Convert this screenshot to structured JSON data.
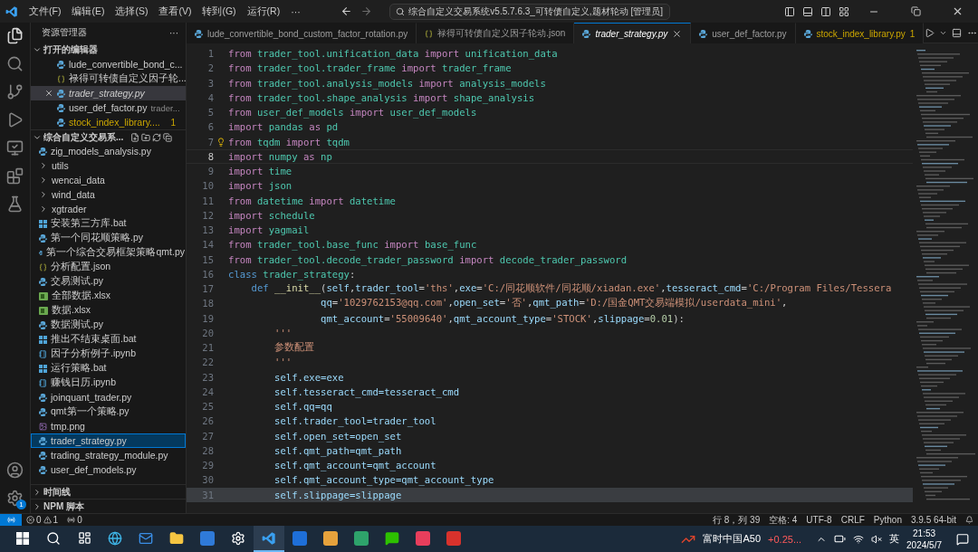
{
  "titlebar": {
    "menus": [
      "文件(F)",
      "编辑(E)",
      "选择(S)",
      "查看(V)",
      "转到(G)",
      "运行(R)",
      "···"
    ],
    "search": "综合自定义交易系统v5.5.7.6.3_可转债自定义,题材轮动 [管理员]"
  },
  "sidebar": {
    "title": "资源管理器",
    "more": "···",
    "open_editors": {
      "title": "打开的编辑器",
      "expanded": true,
      "items": [
        {
          "kind": "py",
          "name": "lude_convertible_bond_c...",
          "italic": false,
          "selected": false,
          "warning": false
        },
        {
          "kind": "json",
          "name": "禄得可转债自定义因子轮...",
          "italic": false,
          "selected": false,
          "warning": false
        },
        {
          "kind": "py",
          "name": "trader_strategy.py",
          "italic": true,
          "selected": true,
          "warning": false
        },
        {
          "kind": "py",
          "name": "user_def_factor.py",
          "description": "trader...",
          "italic": false,
          "selected": false,
          "warning": false
        },
        {
          "kind": "py",
          "name": "stock_index_library....",
          "badge": "1",
          "italic": false,
          "selected": false,
          "warning": true
        }
      ]
    },
    "folder": {
      "title": "综合自定义交易系...",
      "expanded": true,
      "items": [
        {
          "kind": "py",
          "name": "zig_models_analysis.py",
          "selected": false
        },
        {
          "kind": "folder",
          "name": "utils",
          "selected": false
        },
        {
          "kind": "folder",
          "name": "wencai_data",
          "selected": false
        },
        {
          "kind": "folder",
          "name": "wind_data",
          "selected": false
        },
        {
          "kind": "folder",
          "name": "xgtrader",
          "selected": false
        },
        {
          "kind": "bat",
          "name": "安装第三方库.bat",
          "selected": false
        },
        {
          "kind": "py",
          "name": "第一个同花顺策略.py",
          "selected": false
        },
        {
          "kind": "py",
          "name": "第一个综合交易框架策略qmt.py",
          "selected": false
        },
        {
          "kind": "json",
          "name": "分析配置.json",
          "selected": false
        },
        {
          "kind": "py",
          "name": "交易测试.py",
          "selected": false
        },
        {
          "kind": "xlsx",
          "name": "全部数据.xlsx",
          "selected": false
        },
        {
          "kind": "xlsx",
          "name": "数据.xlsx",
          "selected": false
        },
        {
          "kind": "py",
          "name": "数据测试.py",
          "selected": false
        },
        {
          "kind": "bat",
          "name": "推出不结束桌面.bat",
          "selected": false
        },
        {
          "kind": "ipynb",
          "name": "因子分析例子.ipynb",
          "selected": false
        },
        {
          "kind": "bat",
          "name": "运行策略.bat",
          "selected": false
        },
        {
          "kind": "ipynb",
          "name": "赚钱日历.ipynb",
          "selected": false
        },
        {
          "kind": "py",
          "name": "joinquant_trader.py",
          "selected": false
        },
        {
          "kind": "py",
          "name": "qmt第一个策略.py",
          "selected": false
        },
        {
          "kind": "png",
          "name": "tmp.png",
          "selected": false
        },
        {
          "kind": "py",
          "name": "trader_strategy.py",
          "selected": true
        },
        {
          "kind": "py",
          "name": "trading_strategy_module.py",
          "selected": false
        },
        {
          "kind": "py",
          "name": "user_def_models.py",
          "selected": false
        }
      ]
    },
    "bottom_sections": [
      {
        "title": "时间线",
        "expanded": false
      },
      {
        "title": "NPM 脚本",
        "expanded": false
      }
    ]
  },
  "activity_bar": {
    "settings_badge": "1"
  },
  "tabs": [
    {
      "kind": "py",
      "label": "lude_convertible_bond_custom_factor_rotation.py",
      "selected": false,
      "italic": false,
      "warning": false
    },
    {
      "kind": "json",
      "label": "禄得可转债自定义因子轮动.json",
      "selected": false,
      "italic": false,
      "warning": false
    },
    {
      "kind": "py",
      "label": "trader_strategy.py",
      "selected": true,
      "italic": true,
      "warning": false
    },
    {
      "kind": "py",
      "label": "user_def_factor.py",
      "selected": false,
      "italic": false,
      "warning": false
    },
    {
      "kind": "py",
      "label": "stock_index_library.py",
      "badge": "1",
      "selected": false,
      "italic": false,
      "warning": true
    }
  ],
  "editor": {
    "lines": [
      {
        "n": "1",
        "current": false,
        "selected": false,
        "lightbulb": false,
        "tokens": [
          {
            "kind": "keyword",
            "text": "from "
          },
          {
            "kind": "module",
            "text": "trader_tool.unification_data "
          },
          {
            "kind": "keyword",
            "text": "import "
          },
          {
            "kind": "module",
            "text": "unification_data"
          }
        ]
      },
      {
        "n": "2",
        "current": false,
        "selected": false,
        "lightbulb": false,
        "tokens": [
          {
            "kind": "keyword",
            "text": "from "
          },
          {
            "kind": "module",
            "text": "trader_tool.trader_frame "
          },
          {
            "kind": "keyword",
            "text": "import "
          },
          {
            "kind": "module",
            "text": "trader_frame"
          }
        ]
      },
      {
        "n": "3",
        "current": false,
        "selected": false,
        "lightbulb": false,
        "tokens": [
          {
            "kind": "keyword",
            "text": "from "
          },
          {
            "kind": "module",
            "text": "trader_tool.analysis_models "
          },
          {
            "kind": "keyword",
            "text": "import "
          },
          {
            "kind": "module",
            "text": "analysis_models"
          }
        ]
      },
      {
        "n": "4",
        "current": false,
        "selected": false,
        "lightbulb": false,
        "tokens": [
          {
            "kind": "keyword",
            "text": "from "
          },
          {
            "kind": "module",
            "text": "trader_tool.shape_analysis "
          },
          {
            "kind": "keyword",
            "text": "import "
          },
          {
            "kind": "module",
            "text": "shape_analysis"
          }
        ]
      },
      {
        "n": "5",
        "current": false,
        "selected": false,
        "lightbulb": false,
        "tokens": [
          {
            "kind": "keyword",
            "text": "from "
          },
          {
            "kind": "module",
            "text": "user_def_models "
          },
          {
            "kind": "keyword",
            "text": "import "
          },
          {
            "kind": "module",
            "text": "user_def_models"
          }
        ]
      },
      {
        "n": "6",
        "current": false,
        "selected": false,
        "lightbulb": false,
        "tokens": [
          {
            "kind": "keyword",
            "text": "import "
          },
          {
            "kind": "module",
            "text": "pandas "
          },
          {
            "kind": "keyword",
            "text": "as "
          },
          {
            "kind": "module",
            "text": "pd"
          }
        ]
      },
      {
        "n": "7",
        "current": false,
        "selected": false,
        "lightbulb": true,
        "tokens": [
          {
            "kind": "keyword",
            "text": "from "
          },
          {
            "kind": "module",
            "text": "tqdm "
          },
          {
            "kind": "keyword",
            "text": "import "
          },
          {
            "kind": "module",
            "text": "tqdm"
          }
        ]
      },
      {
        "n": "8",
        "current": true,
        "selected": false,
        "lightbulb": false,
        "tokens": [
          {
            "kind": "keyword",
            "text": "import "
          },
          {
            "kind": "module",
            "text": "numpy "
          },
          {
            "kind": "keyword",
            "text": "as "
          },
          {
            "kind": "module",
            "text": "np"
          }
        ]
      },
      {
        "n": "9",
        "current": false,
        "selected": false,
        "lightbulb": false,
        "tokens": [
          {
            "kind": "keyword",
            "text": "import "
          },
          {
            "kind": "module",
            "text": "time"
          }
        ]
      },
      {
        "n": "10",
        "current": false,
        "selected": false,
        "lightbulb": false,
        "tokens": [
          {
            "kind": "keyword",
            "text": "import "
          },
          {
            "kind": "module",
            "text": "json"
          }
        ]
      },
      {
        "n": "11",
        "current": false,
        "selected": false,
        "lightbulb": false,
        "tokens": [
          {
            "kind": "keyword",
            "text": "from "
          },
          {
            "kind": "module",
            "text": "datetime "
          },
          {
            "kind": "keyword",
            "text": "import "
          },
          {
            "kind": "module",
            "text": "datetime"
          }
        ]
      },
      {
        "n": "12",
        "current": false,
        "selected": false,
        "lightbulb": false,
        "tokens": [
          {
            "kind": "keyword",
            "text": "import "
          },
          {
            "kind": "module",
            "text": "schedule"
          }
        ]
      },
      {
        "n": "13",
        "current": false,
        "selected": false,
        "lightbulb": false,
        "tokens": [
          {
            "kind": "keyword",
            "text": "import "
          },
          {
            "kind": "module",
            "text": "yagmail"
          }
        ]
      },
      {
        "n": "14",
        "current": false,
        "selected": false,
        "lightbulb": false,
        "tokens": [
          {
            "kind": "keyword",
            "text": "from "
          },
          {
            "kind": "module",
            "text": "trader_tool.base_func "
          },
          {
            "kind": "keyword",
            "text": "import "
          },
          {
            "kind": "module",
            "text": "base_func"
          }
        ]
      },
      {
        "n": "15",
        "current": false,
        "selected": false,
        "lightbulb": false,
        "tokens": [
          {
            "kind": "keyword",
            "text": "from "
          },
          {
            "kind": "module",
            "text": "trader_tool.decode_trader_password "
          },
          {
            "kind": "keyword",
            "text": "import "
          },
          {
            "kind": "module",
            "text": "decode_trader_password"
          }
        ]
      },
      {
        "n": "16",
        "current": false,
        "selected": false,
        "lightbulb": false,
        "tokens": [
          {
            "kind": "storage",
            "text": "class "
          },
          {
            "kind": "module",
            "text": "trader_strategy"
          },
          {
            "kind": "plain",
            "text": ":"
          }
        ]
      },
      {
        "n": "17",
        "current": false,
        "selected": false,
        "lightbulb": false,
        "tokens": [
          {
            "kind": "storage",
            "text": "    def "
          },
          {
            "kind": "function",
            "text": "__init__"
          },
          {
            "kind": "plain",
            "text": "("
          },
          {
            "kind": "variable",
            "text": "self"
          },
          {
            "kind": "plain",
            "text": ","
          },
          {
            "kind": "variable",
            "text": "trader_tool"
          },
          {
            "kind": "plain",
            "text": "="
          },
          {
            "kind": "string",
            "text": "'ths'"
          },
          {
            "kind": "plain",
            "text": ","
          },
          {
            "kind": "variable",
            "text": "exe"
          },
          {
            "kind": "plain",
            "text": "="
          },
          {
            "kind": "string",
            "text": "'C:/同花顺软件/同花顺/xiadan.exe'"
          },
          {
            "kind": "plain",
            "text": ","
          },
          {
            "kind": "variable",
            "text": "tesseract_cmd"
          },
          {
            "kind": "plain",
            "text": "="
          },
          {
            "kind": "string",
            "text": "'C:/Program Files/Tessera"
          }
        ]
      },
      {
        "n": "18",
        "current": false,
        "selected": false,
        "lightbulb": false,
        "tokens": [
          {
            "kind": "variable",
            "text": "                qq"
          },
          {
            "kind": "plain",
            "text": "="
          },
          {
            "kind": "string",
            "text": "'1029762153@qq.com'"
          },
          {
            "kind": "plain",
            "text": ","
          },
          {
            "kind": "variable",
            "text": "open_set"
          },
          {
            "kind": "plain",
            "text": "="
          },
          {
            "kind": "string",
            "text": "'否'"
          },
          {
            "kind": "plain",
            "text": ","
          },
          {
            "kind": "variable",
            "text": "qmt_path"
          },
          {
            "kind": "plain",
            "text": "="
          },
          {
            "kind": "string",
            "text": "'D:/国金QMT交易端模拟/userdata_mini'"
          },
          {
            "kind": "plain",
            "text": ","
          }
        ]
      },
      {
        "n": "19",
        "current": false,
        "selected": false,
        "lightbulb": false,
        "tokens": [
          {
            "kind": "variable",
            "text": "                qmt_account"
          },
          {
            "kind": "plain",
            "text": "="
          },
          {
            "kind": "string",
            "text": "'55009640'"
          },
          {
            "kind": "plain",
            "text": ","
          },
          {
            "kind": "variable",
            "text": "qmt_account_type"
          },
          {
            "kind": "plain",
            "text": "="
          },
          {
            "kind": "string",
            "text": "'STOCK'"
          },
          {
            "kind": "plain",
            "text": ","
          },
          {
            "kind": "variable",
            "text": "slippage"
          },
          {
            "kind": "plain",
            "text": "="
          },
          {
            "kind": "number",
            "text": "0.01"
          },
          {
            "kind": "plain",
            "text": "):"
          }
        ]
      },
      {
        "n": "20",
        "current": false,
        "selected": false,
        "lightbulb": false,
        "tokens": [
          {
            "kind": "string",
            "text": "        '''"
          }
        ]
      },
      {
        "n": "21",
        "current": false,
        "selected": false,
        "lightbulb": false,
        "tokens": [
          {
            "kind": "string",
            "text": "        参数配置"
          }
        ]
      },
      {
        "n": "22",
        "current": false,
        "selected": false,
        "lightbulb": false,
        "tokens": [
          {
            "kind": "string",
            "text": "        '''"
          }
        ]
      },
      {
        "n": "23",
        "current": false,
        "selected": false,
        "lightbulb": false,
        "tokens": [
          {
            "kind": "variable",
            "text": "        self.exe=exe"
          }
        ]
      },
      {
        "n": "24",
        "current": false,
        "selected": false,
        "lightbulb": false,
        "tokens": [
          {
            "kind": "variable",
            "text": "        self.tesseract_cmd=tesseract_cmd"
          }
        ]
      },
      {
        "n": "25",
        "current": false,
        "selected": false,
        "lightbulb": false,
        "tokens": [
          {
            "kind": "variable",
            "text": "        self.qq=qq"
          }
        ]
      },
      {
        "n": "26",
        "current": false,
        "selected": false,
        "lightbulb": false,
        "tokens": [
          {
            "kind": "variable",
            "text": "        self.trader_tool=trader_tool"
          }
        ]
      },
      {
        "n": "27",
        "current": false,
        "selected": false,
        "lightbulb": false,
        "tokens": [
          {
            "kind": "variable",
            "text": "        self.open_set=open_set"
          }
        ]
      },
      {
        "n": "28",
        "current": false,
        "selected": false,
        "lightbulb": false,
        "tokens": [
          {
            "kind": "variable",
            "text": "        self.qmt_path=qmt_path"
          }
        ]
      },
      {
        "n": "29",
        "current": false,
        "selected": false,
        "lightbulb": false,
        "tokens": [
          {
            "kind": "variable",
            "text": "        self.qmt_account=qmt_account"
          }
        ]
      },
      {
        "n": "30",
        "current": false,
        "selected": false,
        "lightbulb": false,
        "tokens": [
          {
            "kind": "variable",
            "text": "        self.qmt_account_type=qmt_account_type"
          }
        ]
      },
      {
        "n": "31",
        "current": false,
        "selected": true,
        "lightbulb": false,
        "tokens": [
          {
            "kind": "variable",
            "text": "        self.slippage=slippage"
          }
        ]
      }
    ]
  },
  "status_bar": {
    "errors": "0",
    "warnings": "1",
    "ports": "0",
    "right": [
      "行 8，列 39",
      "空格: 4",
      "UTF-8",
      "CRLF",
      "Python",
      "3.9.5 64-bit"
    ]
  },
  "taskbar": {
    "ticker_name": "富时中国A50",
    "ticker_change": "+0.25...",
    "ime": "英",
    "time": "21:53",
    "date": "2024/5/7"
  }
}
